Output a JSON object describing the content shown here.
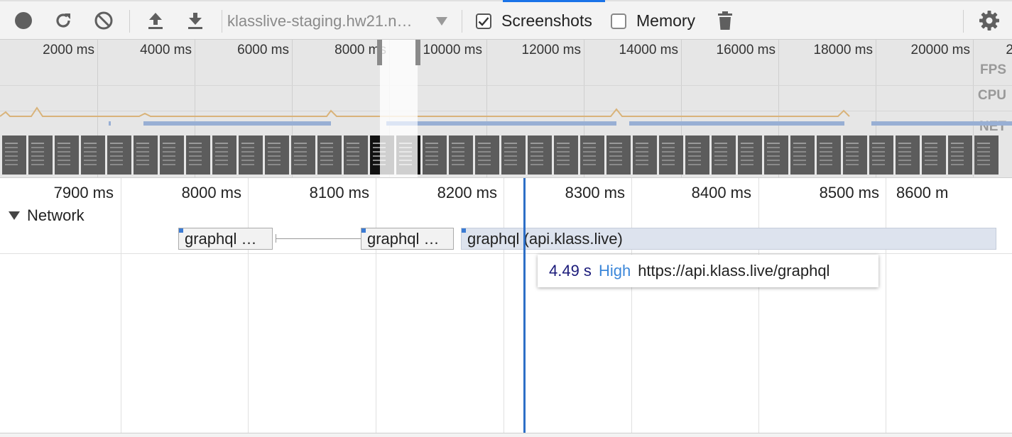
{
  "toolbar": {
    "record_icon": "record-icon",
    "reload_icon": "reload-icon",
    "clear_icon": "clear-icon",
    "load_icon": "upload-icon",
    "save_icon": "download-icon",
    "url_selected": "klasslive-staging.hw21.n…",
    "screenshots_label": "Screenshots",
    "screenshots_checked": true,
    "memory_label": "Memory",
    "memory_checked": false,
    "gc_icon": "trash-icon",
    "settings_icon": "gear-icon"
  },
  "overview": {
    "ticks": [
      "2000 ms",
      "4000 ms",
      "6000 ms",
      "8000 ms",
      "10000 ms",
      "12000 ms",
      "14000 ms",
      "16000 ms",
      "18000 ms",
      "20000 ms",
      "2"
    ],
    "labels": {
      "fps": "FPS",
      "cpu": "CPU",
      "net": "NET"
    }
  },
  "flamechart": {
    "ticks": [
      "7900 ms",
      "8000 ms",
      "8100 ms",
      "8200 ms",
      "8300 ms",
      "8400 ms",
      "8500 ms",
      "8600 m"
    ],
    "section_title": "Network",
    "requests": [
      {
        "label": "graphql …"
      },
      {
        "label": "graphql …"
      },
      {
        "label": "graphql (api.klass.live)"
      }
    ]
  },
  "tooltip": {
    "duration": "4.49 s",
    "priority": "High",
    "url": "https://api.klass.live/graphql"
  },
  "colors": {
    "accent": "#2e6fc7",
    "priority": "#3c87d9",
    "net_bar": "#98afd4"
  }
}
